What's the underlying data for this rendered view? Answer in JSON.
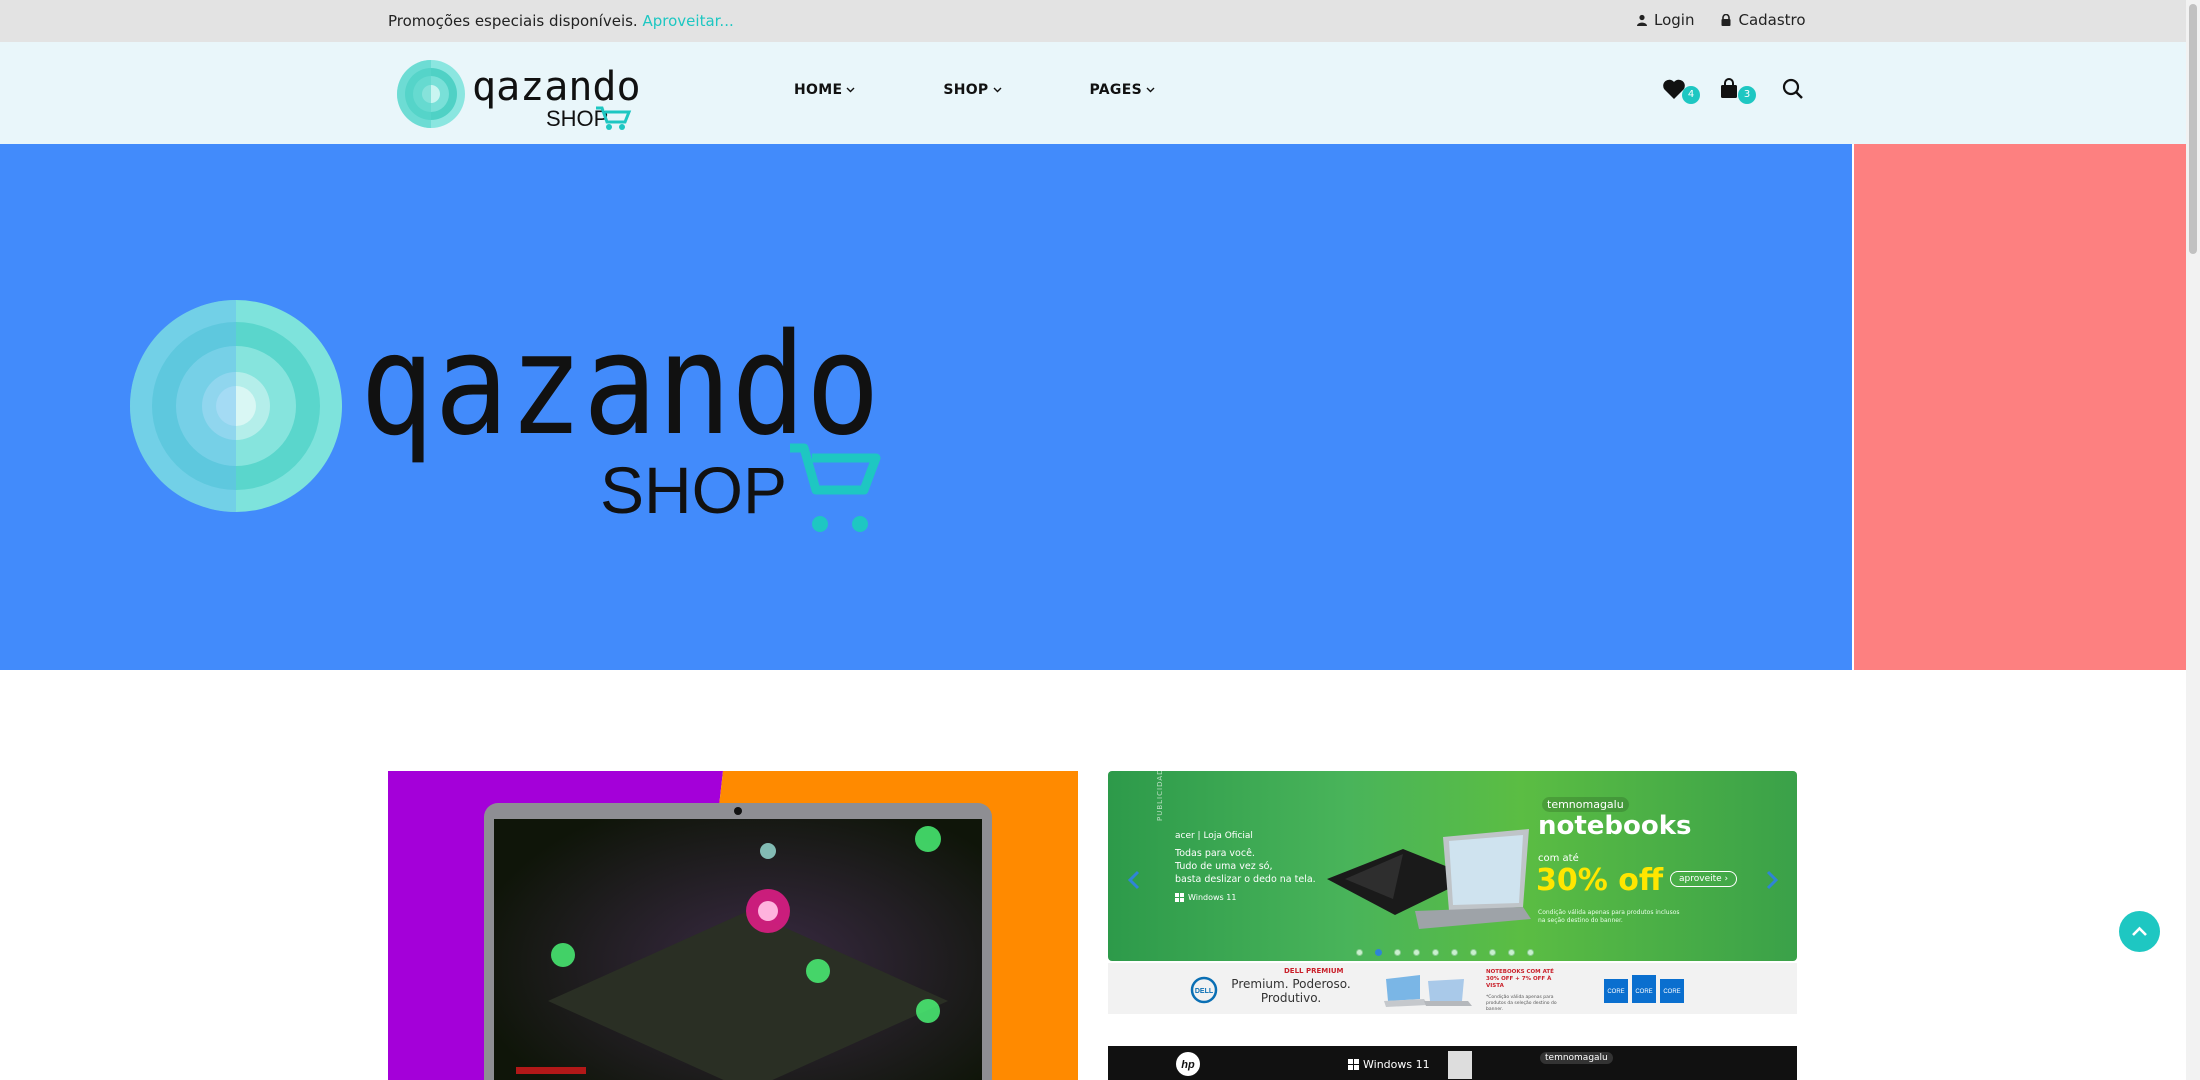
{
  "topbar": {
    "promo_text": "Promoções especiais disponíveis.",
    "promo_link": "Aproveitar...",
    "login_label": "Login",
    "signup_label": "Cadastro"
  },
  "brand": {
    "name": "qazando",
    "sub": "SHOP"
  },
  "nav": {
    "items": [
      {
        "label": "HOME"
      },
      {
        "label": "SHOP"
      },
      {
        "label": "PAGES"
      }
    ]
  },
  "header_icons": {
    "wishlist_count": "4",
    "cart_count": "3"
  },
  "banner_green": {
    "store": "acer | Loja Oficial",
    "line1": "Todas para você.",
    "line2": "Tudo de uma vez só,",
    "line3": "basta deslizar o dedo na tela.",
    "os": "Windows 11",
    "brand_badge": "temnomagalu",
    "headline": "notebooks",
    "prefix": "com até",
    "discount": "30% off",
    "cta": "aproveite ›",
    "fine_print": "Condição válida apenas para produtos inclusos na seção destino do banner.",
    "side_tag": "PUBLICIDADE"
  },
  "banner_dell": {
    "tag": "DELL PREMIUM",
    "line1": "Premium. Poderoso.",
    "line2": "Produtivo.",
    "offer": "NOTEBOOKS COM ATÉ 30% OFF + 7% OFF À VISTA",
    "note": "*Condição válida apenas para produtos da seleção destino do banner."
  },
  "banner_hp": {
    "os": "Windows 11",
    "brand_badge": "temnomagalu"
  },
  "slider": {
    "dot_count": 10,
    "active_dot": 1
  },
  "colors": {
    "accent": "#1ec7c2",
    "hero_blue": "#428bfb",
    "hero_red": "#fd8080"
  }
}
